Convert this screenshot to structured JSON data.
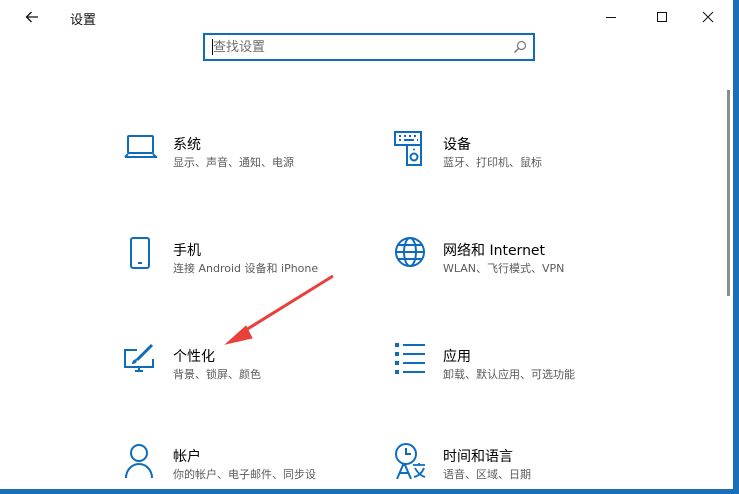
{
  "window": {
    "title": "设置"
  },
  "search": {
    "placeholder": "查找设置"
  },
  "accent": "#0f6cbd",
  "annotation_color": "#e8403b",
  "categories": [
    {
      "icon": "laptop-icon",
      "name": "系统",
      "desc": "显示、声音、通知、电源"
    },
    {
      "icon": "keyboard-speaker-icon",
      "name": "设备",
      "desc": "蓝牙、打印机、鼠标"
    },
    {
      "icon": "phone-icon",
      "name": "手机",
      "desc": "连接 Android 设备和 iPhone"
    },
    {
      "icon": "globe-icon",
      "name": "网络和 Internet",
      "desc": "WLAN、飞行模式、VPN"
    },
    {
      "icon": "paint-display-icon",
      "name": "个性化",
      "desc": "背景、锁屏、颜色"
    },
    {
      "icon": "apps-list-icon",
      "name": "应用",
      "desc": "卸载、默认应用、可选功能"
    },
    {
      "icon": "person-icon",
      "name": "帐户",
      "desc": "你的帐户、电子邮件、同步设"
    },
    {
      "icon": "time-language-icon",
      "name": "时间和语言",
      "desc": "语音、区域、日期"
    }
  ]
}
